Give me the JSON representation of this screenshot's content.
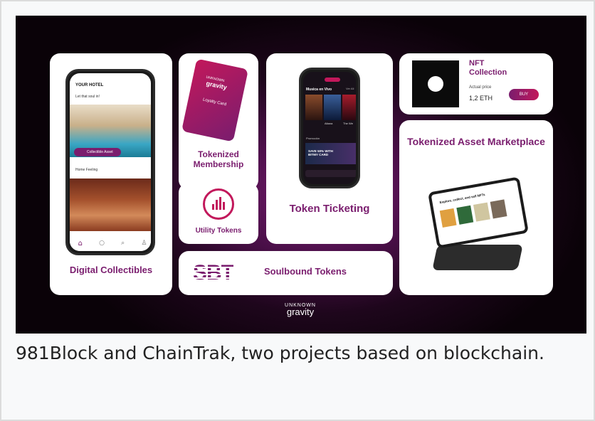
{
  "colors": {
    "accent": "#7a1d6e",
    "pink": "#c2185b",
    "dark": "#1a0614"
  },
  "cards": {
    "digital_collectibles": {
      "title": "Digital Collectibles",
      "phone": {
        "header": "YOUR HOTEL",
        "subtitle": "Let that soul in!",
        "badge": "Collectible Asset",
        "row_label": "Home Feeling",
        "nav_icons": [
          "home-icon",
          "chat-icon",
          "search-icon",
          "user-icon"
        ]
      }
    },
    "tokenized_membership": {
      "title": "Tokenized Membership",
      "card_text": "Loyalty Card",
      "card_logo_top": "UNKNOWN",
      "card_logo_bottom": "gravity"
    },
    "utility_tokens": {
      "title": "Utility Tokens",
      "icon": "equalizer-icon"
    },
    "token_ticketing": {
      "title": "Token Ticketing",
      "phone": {
        "section": "Musica en Vivo",
        "link": "Ver All",
        "events": [
          "Aitana",
          "The We"
        ],
        "promo": "Promoción",
        "promo_text": "SAVE 50% WITH BITMY CARD"
      }
    },
    "nft": {
      "title": "NFT Collection",
      "price_label": "Actual price",
      "price": "1,2 ETH",
      "buy": "BUY"
    },
    "marketplace": {
      "title": "Tokenized Asset Marketplace",
      "tablet_text": "Explore, collect, and sell NFTs"
    },
    "sbt": {
      "badge": "SBT",
      "title": "Soulbound Tokens"
    }
  },
  "logo": {
    "top": "UNKNOWN",
    "bottom": "gravity"
  },
  "caption": "981Block and ChainTrak, two projects based on blockchain."
}
